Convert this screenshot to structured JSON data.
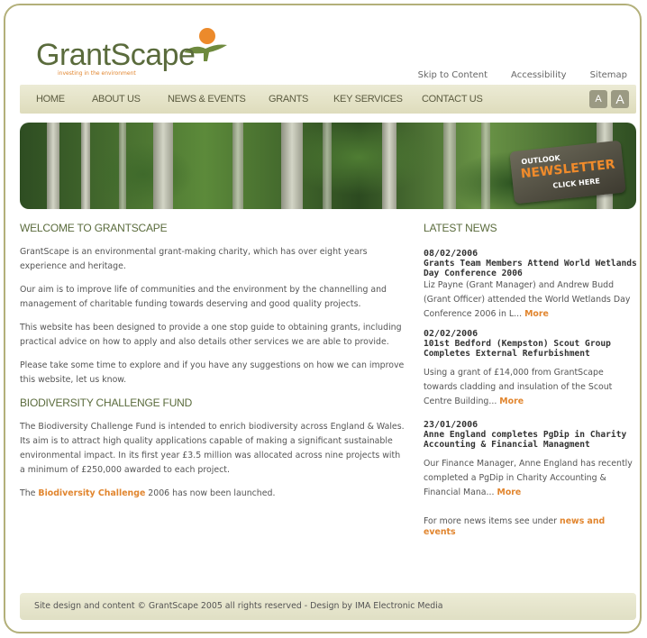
{
  "brand": {
    "name": "GrantScape",
    "tagline": "investing in the environment"
  },
  "top_links": [
    "Skip to Content",
    "Accessibility",
    "Sitemap"
  ],
  "nav": {
    "items": [
      "HOME",
      "ABOUT US",
      "NEWS & EVENTS",
      "GRANTS",
      "KEY SERVICES",
      "CONTACT US"
    ],
    "font_small": "A",
    "font_large": "A"
  },
  "banner": {
    "newsletter_top": "OUTLOOK",
    "newsletter_word": "NEWSLETTER",
    "newsletter_click": "CLICK HERE"
  },
  "welcome": {
    "heading": "WELCOME TO GRANTSCAPE",
    "p1": "GrantScape is an environmental grant-making charity, which has over eight years experience and heritage.",
    "p2": "Our aim is to improve life of communities and the environment by the channelling and management of charitable funding towards deserving and good quality projects.",
    "p3": "This website has been designed to provide a one stop guide to obtaining grants, including practical advice on how to apply and also details other services we are able to provide.",
    "p4": "Please take some time to explore and if you have any suggestions on how we can improve this website, let us know."
  },
  "biodiversity": {
    "heading": "BIODIVERSITY CHALLENGE FUND",
    "p1": "The Biodiversity Challenge Fund is intended to enrich biodiversity across England & Wales. Its aim is to attract high quality applications capable of making a significant sustainable environmental impact. In its first year £3.5 million was allocated across nine projects with a minimum of £250,000 awarded to each project.",
    "p2_before": "The ",
    "p2_link": "Biodiversity Challenge",
    "p2_after": " 2006 has now been launched."
  },
  "news": {
    "heading": "LATEST NEWS",
    "items": [
      {
        "date": "08/02/2006",
        "title": "Grants Team Members Attend World Wetlands Day Conference 2006",
        "body": "Liz Payne (Grant Manager) and Andrew Budd (Grant Officer) attended the World Wetlands Day Conference 2006 in L...",
        "more": "More"
      },
      {
        "date": "02/02/2006",
        "title": "101st Bedford (Kempston) Scout Group Completes External Refurbishment",
        "body": "Using a grant of £14,000 from GrantScape towards cladding and insulation of the Scout Centre Building...",
        "more": "More"
      },
      {
        "date": "23/01/2006",
        "title": "Anne England completes PgDip in Charity Accounting & Financial Managment",
        "body": "Our Finance Manager, Anne England has recently completed a PgDip in Charity Accounting & Financial Mana...",
        "more": "More"
      }
    ],
    "footer_text": "For more news items see under ",
    "footer_link": "news and events"
  },
  "footer": {
    "text": "Site design and content © GrantScape 2005 all rights reserved - Design by IMA Electronic Media"
  },
  "colors": {
    "brand_green": "#5a6b3c",
    "accent_orange": "#e1852e",
    "nav_bg": "#e6e4c9",
    "frame": "#b3b07a"
  }
}
